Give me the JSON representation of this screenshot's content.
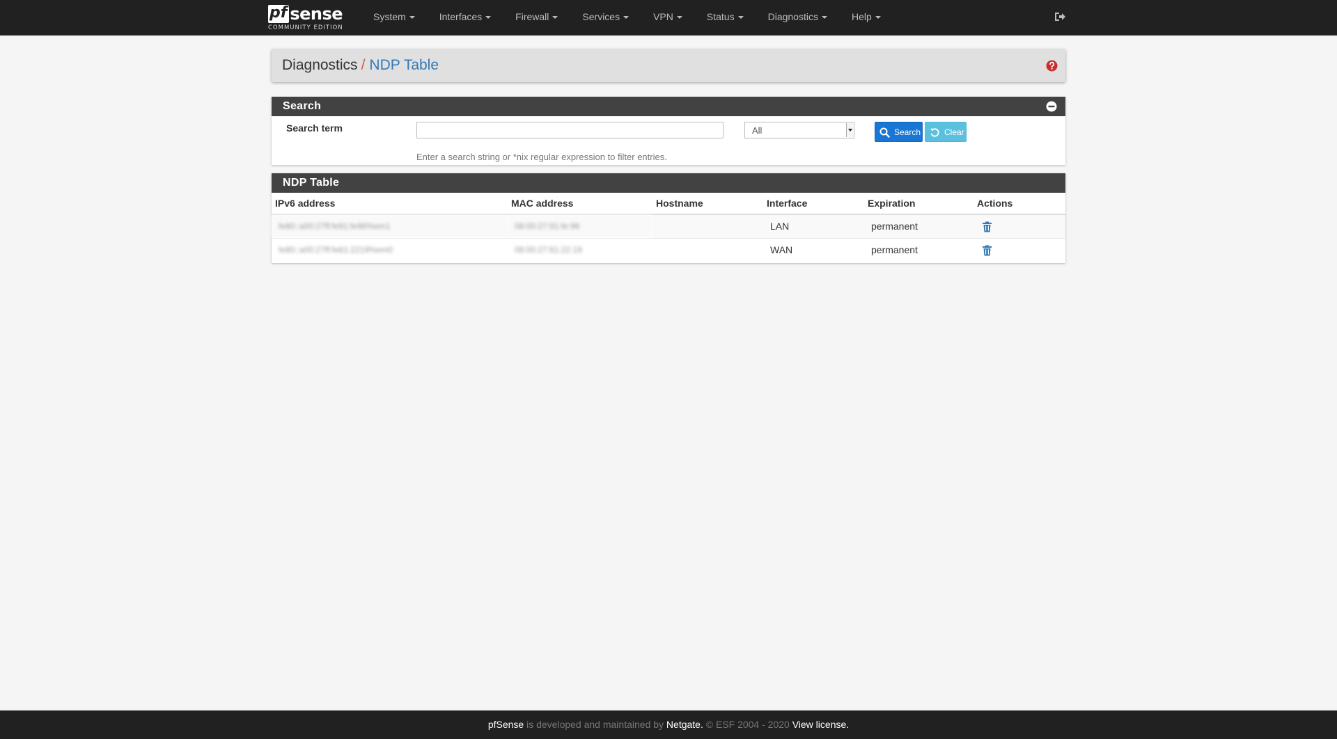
{
  "navbar": {
    "brand_main": "sense",
    "brand_pf": "pf",
    "brand_sub": "COMMUNITY EDITION",
    "menu": [
      "System",
      "Interfaces",
      "Firewall",
      "Services",
      "VPN",
      "Status",
      "Diagnostics",
      "Help"
    ]
  },
  "header": {
    "parent": "Diagnostics",
    "separator": "/",
    "current": "NDP Table"
  },
  "search": {
    "title": "Search",
    "label": "Search term",
    "input_value": "",
    "interface_select": "All",
    "search_button": "Search",
    "clear_button": "Clear",
    "hint": "Enter a search string or *nix regular expression to filter entries."
  },
  "ndp": {
    "title": "NDP Table",
    "columns": [
      "IPv6 address",
      "MAC address",
      "Hostname",
      "Interface",
      "Expiration",
      "Actions"
    ],
    "rows": [
      {
        "ipv6": "fe80::a00:27ff:fe91:fe96%em1",
        "mac": "08:00:27:91:fe:96",
        "hostname": "",
        "interface": "LAN",
        "expiration": "permanent"
      },
      {
        "ipv6": "fe80::a00:27ff:fe81:2219%em0",
        "mac": "08:00:27:81:22:19",
        "hostname": "",
        "interface": "WAN",
        "expiration": "permanent"
      }
    ]
  },
  "footer": {
    "brand": "pfSense",
    "text1": " is developed and maintained by ",
    "company": "Netgate.",
    "text2": " © ESF 2004 - 2020 ",
    "license": "View license."
  },
  "colors": {
    "navbar": "#212121",
    "panel_heading": "#424242",
    "accent_blue": "#1976d2",
    "clear_blue": "#5bc0de",
    "link": "#337ab7",
    "danger": "#d9534f"
  }
}
